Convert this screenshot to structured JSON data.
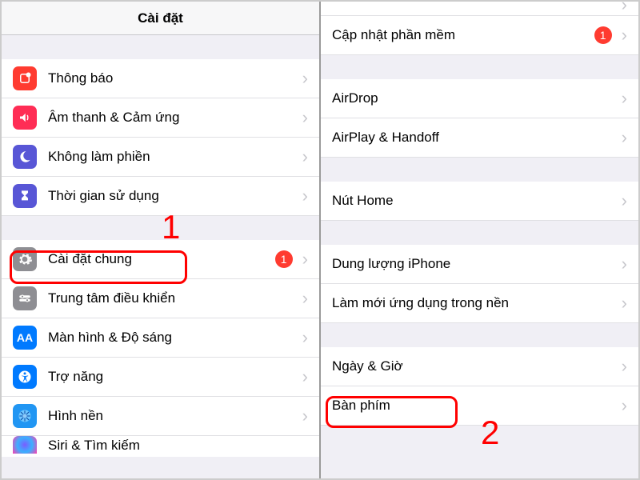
{
  "left": {
    "title": "Cài đặt",
    "group1": [
      {
        "label": "Thông báo",
        "icon": "notif"
      },
      {
        "label": "Âm thanh & Cảm ứng",
        "icon": "sound"
      },
      {
        "label": "Không làm phiền",
        "icon": "dnd"
      },
      {
        "label": "Thời gian sử dụng",
        "icon": "screen"
      }
    ],
    "group2": [
      {
        "label": "Cài đặt chung",
        "icon": "general",
        "badge": "1"
      },
      {
        "label": "Trung tâm điều khiển",
        "icon": "control"
      },
      {
        "label": "Màn hình & Độ sáng",
        "icon": "display"
      },
      {
        "label": "Trợ năng",
        "icon": "access"
      },
      {
        "label": "Hình nền",
        "icon": "wall"
      },
      {
        "label": "Siri & Tìm kiếm",
        "icon": "siri"
      }
    ],
    "annot_number": "1"
  },
  "right": {
    "partial_top_label": "",
    "group1": [
      {
        "label": "Cập nhật phần mềm",
        "badge": "1"
      }
    ],
    "group2": [
      {
        "label": "AirDrop"
      },
      {
        "label": "AirPlay & Handoff"
      }
    ],
    "group3": [
      {
        "label": "Nút Home"
      }
    ],
    "group4": [
      {
        "label": "Dung lượng iPhone"
      },
      {
        "label": "Làm mới ứng dụng trong nền"
      }
    ],
    "group5": [
      {
        "label": "Ngày & Giờ"
      },
      {
        "label": "Bàn phím"
      }
    ],
    "annot_number": "2"
  }
}
